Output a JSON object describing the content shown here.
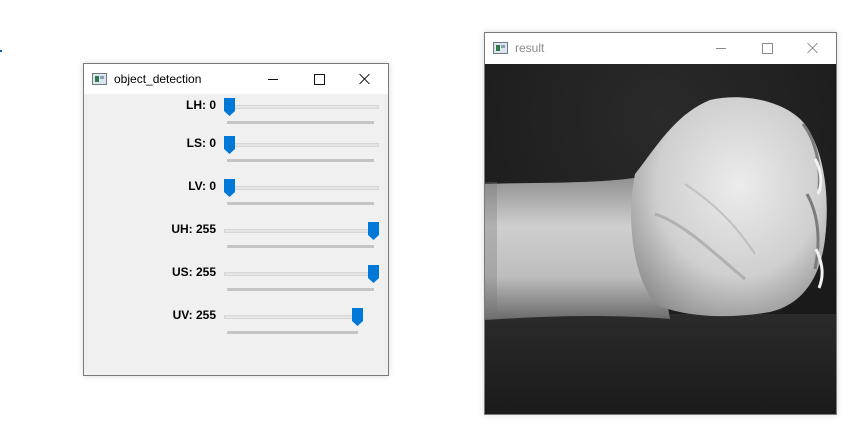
{
  "detect_window": {
    "title": "object_detection",
    "trackbars": [
      {
        "label": "LH: 0",
        "value": 0,
        "max": 255
      },
      {
        "label": "LS: 0",
        "value": 0,
        "max": 255
      },
      {
        "label": "LV: 0",
        "value": 0,
        "max": 255
      },
      {
        "label": "UH: 255",
        "value": 255,
        "max": 255
      },
      {
        "label": "US: 255",
        "value": 255,
        "max": 255
      },
      {
        "label": "UV: 255",
        "value": 255,
        "max": 255
      }
    ]
  },
  "result_window": {
    "title": "result"
  },
  "colors": {
    "thumb": "#0078d7",
    "window_bg": "#f0f0f0",
    "titlebar_bg": "#ffffff"
  },
  "icons": {
    "app": "window-app-icon",
    "minimize": "minimize-icon",
    "maximize": "maximize-icon",
    "close": "close-icon"
  }
}
